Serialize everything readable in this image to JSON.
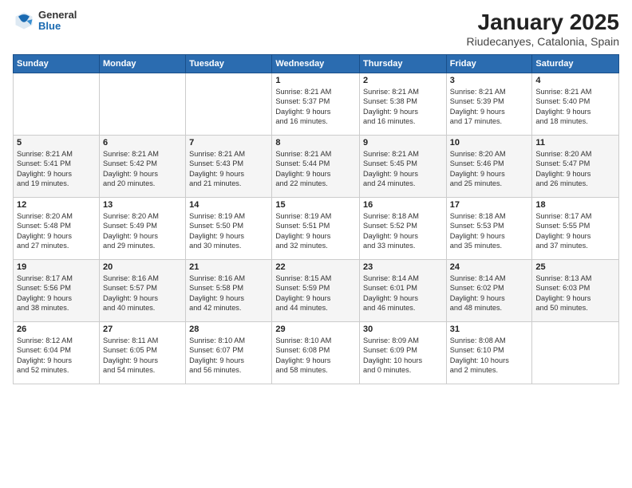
{
  "header": {
    "logo_general": "General",
    "logo_blue": "Blue",
    "title": "January 2025",
    "subtitle": "Riudecanyes, Catalonia, Spain"
  },
  "weekdays": [
    "Sunday",
    "Monday",
    "Tuesday",
    "Wednesday",
    "Thursday",
    "Friday",
    "Saturday"
  ],
  "weeks": [
    [
      {
        "day": "",
        "info": ""
      },
      {
        "day": "",
        "info": ""
      },
      {
        "day": "",
        "info": ""
      },
      {
        "day": "1",
        "info": "Sunrise: 8:21 AM\nSunset: 5:37 PM\nDaylight: 9 hours\nand 16 minutes."
      },
      {
        "day": "2",
        "info": "Sunrise: 8:21 AM\nSunset: 5:38 PM\nDaylight: 9 hours\nand 16 minutes."
      },
      {
        "day": "3",
        "info": "Sunrise: 8:21 AM\nSunset: 5:39 PM\nDaylight: 9 hours\nand 17 minutes."
      },
      {
        "day": "4",
        "info": "Sunrise: 8:21 AM\nSunset: 5:40 PM\nDaylight: 9 hours\nand 18 minutes."
      }
    ],
    [
      {
        "day": "5",
        "info": "Sunrise: 8:21 AM\nSunset: 5:41 PM\nDaylight: 9 hours\nand 19 minutes."
      },
      {
        "day": "6",
        "info": "Sunrise: 8:21 AM\nSunset: 5:42 PM\nDaylight: 9 hours\nand 20 minutes."
      },
      {
        "day": "7",
        "info": "Sunrise: 8:21 AM\nSunset: 5:43 PM\nDaylight: 9 hours\nand 21 minutes."
      },
      {
        "day": "8",
        "info": "Sunrise: 8:21 AM\nSunset: 5:44 PM\nDaylight: 9 hours\nand 22 minutes."
      },
      {
        "day": "9",
        "info": "Sunrise: 8:21 AM\nSunset: 5:45 PM\nDaylight: 9 hours\nand 24 minutes."
      },
      {
        "day": "10",
        "info": "Sunrise: 8:20 AM\nSunset: 5:46 PM\nDaylight: 9 hours\nand 25 minutes."
      },
      {
        "day": "11",
        "info": "Sunrise: 8:20 AM\nSunset: 5:47 PM\nDaylight: 9 hours\nand 26 minutes."
      }
    ],
    [
      {
        "day": "12",
        "info": "Sunrise: 8:20 AM\nSunset: 5:48 PM\nDaylight: 9 hours\nand 27 minutes."
      },
      {
        "day": "13",
        "info": "Sunrise: 8:20 AM\nSunset: 5:49 PM\nDaylight: 9 hours\nand 29 minutes."
      },
      {
        "day": "14",
        "info": "Sunrise: 8:19 AM\nSunset: 5:50 PM\nDaylight: 9 hours\nand 30 minutes."
      },
      {
        "day": "15",
        "info": "Sunrise: 8:19 AM\nSunset: 5:51 PM\nDaylight: 9 hours\nand 32 minutes."
      },
      {
        "day": "16",
        "info": "Sunrise: 8:18 AM\nSunset: 5:52 PM\nDaylight: 9 hours\nand 33 minutes."
      },
      {
        "day": "17",
        "info": "Sunrise: 8:18 AM\nSunset: 5:53 PM\nDaylight: 9 hours\nand 35 minutes."
      },
      {
        "day": "18",
        "info": "Sunrise: 8:17 AM\nSunset: 5:55 PM\nDaylight: 9 hours\nand 37 minutes."
      }
    ],
    [
      {
        "day": "19",
        "info": "Sunrise: 8:17 AM\nSunset: 5:56 PM\nDaylight: 9 hours\nand 38 minutes."
      },
      {
        "day": "20",
        "info": "Sunrise: 8:16 AM\nSunset: 5:57 PM\nDaylight: 9 hours\nand 40 minutes."
      },
      {
        "day": "21",
        "info": "Sunrise: 8:16 AM\nSunset: 5:58 PM\nDaylight: 9 hours\nand 42 minutes."
      },
      {
        "day": "22",
        "info": "Sunrise: 8:15 AM\nSunset: 5:59 PM\nDaylight: 9 hours\nand 44 minutes."
      },
      {
        "day": "23",
        "info": "Sunrise: 8:14 AM\nSunset: 6:01 PM\nDaylight: 9 hours\nand 46 minutes."
      },
      {
        "day": "24",
        "info": "Sunrise: 8:14 AM\nSunset: 6:02 PM\nDaylight: 9 hours\nand 48 minutes."
      },
      {
        "day": "25",
        "info": "Sunrise: 8:13 AM\nSunset: 6:03 PM\nDaylight: 9 hours\nand 50 minutes."
      }
    ],
    [
      {
        "day": "26",
        "info": "Sunrise: 8:12 AM\nSunset: 6:04 PM\nDaylight: 9 hours\nand 52 minutes."
      },
      {
        "day": "27",
        "info": "Sunrise: 8:11 AM\nSunset: 6:05 PM\nDaylight: 9 hours\nand 54 minutes."
      },
      {
        "day": "28",
        "info": "Sunrise: 8:10 AM\nSunset: 6:07 PM\nDaylight: 9 hours\nand 56 minutes."
      },
      {
        "day": "29",
        "info": "Sunrise: 8:10 AM\nSunset: 6:08 PM\nDaylight: 9 hours\nand 58 minutes."
      },
      {
        "day": "30",
        "info": "Sunrise: 8:09 AM\nSunset: 6:09 PM\nDaylight: 10 hours\nand 0 minutes."
      },
      {
        "day": "31",
        "info": "Sunrise: 8:08 AM\nSunset: 6:10 PM\nDaylight: 10 hours\nand 2 minutes."
      },
      {
        "day": "",
        "info": ""
      }
    ]
  ]
}
